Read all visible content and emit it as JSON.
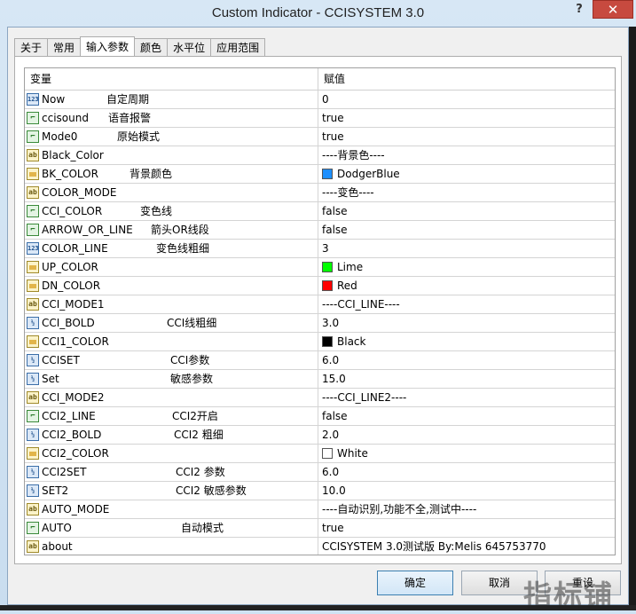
{
  "window": {
    "title": "Custom Indicator - CCISYSTEM 3.0",
    "help": "?",
    "close": "✕"
  },
  "tabs": [
    {
      "label": "关于"
    },
    {
      "label": "常用"
    },
    {
      "label": "输入参数"
    },
    {
      "label": "颜色"
    },
    {
      "label": "水平位"
    },
    {
      "label": "应用范围"
    }
  ],
  "grid": {
    "col_name": "变量",
    "col_value": "赋值",
    "rows": [
      {
        "name": "Now",
        "note": "自定周期",
        "value": "0",
        "icon": "int"
      },
      {
        "name": "ccisound",
        "note": "语音报警",
        "value": "true",
        "icon": "bool"
      },
      {
        "name": "Mode0",
        "note": "原始模式",
        "value": "true",
        "icon": "bool"
      },
      {
        "name": "Black_Color",
        "note": "",
        "value": "----背景色----",
        "icon": "str"
      },
      {
        "name": "BK_COLOR",
        "note": "背景颜色",
        "value": "DodgerBlue",
        "icon": "color",
        "swatch": "#1e90ff"
      },
      {
        "name": "COLOR_MODE",
        "note": "",
        "value": "----变色----",
        "icon": "str"
      },
      {
        "name": "CCI_COLOR",
        "note": "变色线",
        "value": "false",
        "icon": "bool"
      },
      {
        "name": "ARROW_OR_LINE",
        "note": "箭头OR线段",
        "value": "false",
        "icon": "bool"
      },
      {
        "name": "COLOR_LINE",
        "note": "变色线粗细",
        "value": "3",
        "icon": "int"
      },
      {
        "name": "UP_COLOR",
        "note": "",
        "value": "Lime",
        "icon": "color",
        "swatch": "#00ff00"
      },
      {
        "name": "DN_COLOR",
        "note": "",
        "value": "Red",
        "icon": "color",
        "swatch": "#ff0000"
      },
      {
        "name": "CCI_MODE1",
        "note": "",
        "value": "----CCI_LINE----",
        "icon": "str"
      },
      {
        "name": "CCI_BOLD",
        "note": "CCI线粗细",
        "value": "3.0",
        "icon": "dbl"
      },
      {
        "name": "CCI1_COLOR",
        "note": "",
        "value": "Black",
        "icon": "color",
        "swatch": "#000000"
      },
      {
        "name": "CCISET",
        "note": "CCI参数",
        "value": "6.0",
        "icon": "dbl"
      },
      {
        "name": "Set",
        "note": "敏感参数",
        "value": "15.0",
        "icon": "dbl"
      },
      {
        "name": "CCI_MODE2",
        "note": "",
        "value": "----CCI_LINE2----",
        "icon": "str"
      },
      {
        "name": "CCI2_LINE",
        "note": "CCI2开启",
        "value": "false",
        "icon": "bool"
      },
      {
        "name": "CCI2_BOLD",
        "note": "CCI2 粗细",
        "value": "2.0",
        "icon": "dbl"
      },
      {
        "name": "CCI2_COLOR",
        "note": "",
        "value": "White",
        "icon": "color",
        "swatch": "#ffffff"
      },
      {
        "name": "CCI2SET",
        "note": "CCI2 参数",
        "value": "6.0",
        "icon": "dbl"
      },
      {
        "name": "SET2",
        "note": "CCI2 敏感参数",
        "value": "10.0",
        "icon": "dbl"
      },
      {
        "name": "AUTO_MODE",
        "note": "",
        "value": "----自动识别,功能不全,测试中----",
        "icon": "str"
      },
      {
        "name": "AUTO",
        "note": "自动模式",
        "value": "true",
        "icon": "bool"
      },
      {
        "name": "about",
        "note": "",
        "value": "CCISYSTEM 3.0测试版 By:Melis 645753770",
        "icon": "str"
      }
    ]
  },
  "buttons": {
    "ok": "确定",
    "cancel": "取消",
    "reset": "重设"
  },
  "watermark": "指标铺",
  "colors": {
    "close_button": "#c74a3f",
    "title_background": "#d7e7f5",
    "accent": "#3c7fb1"
  }
}
